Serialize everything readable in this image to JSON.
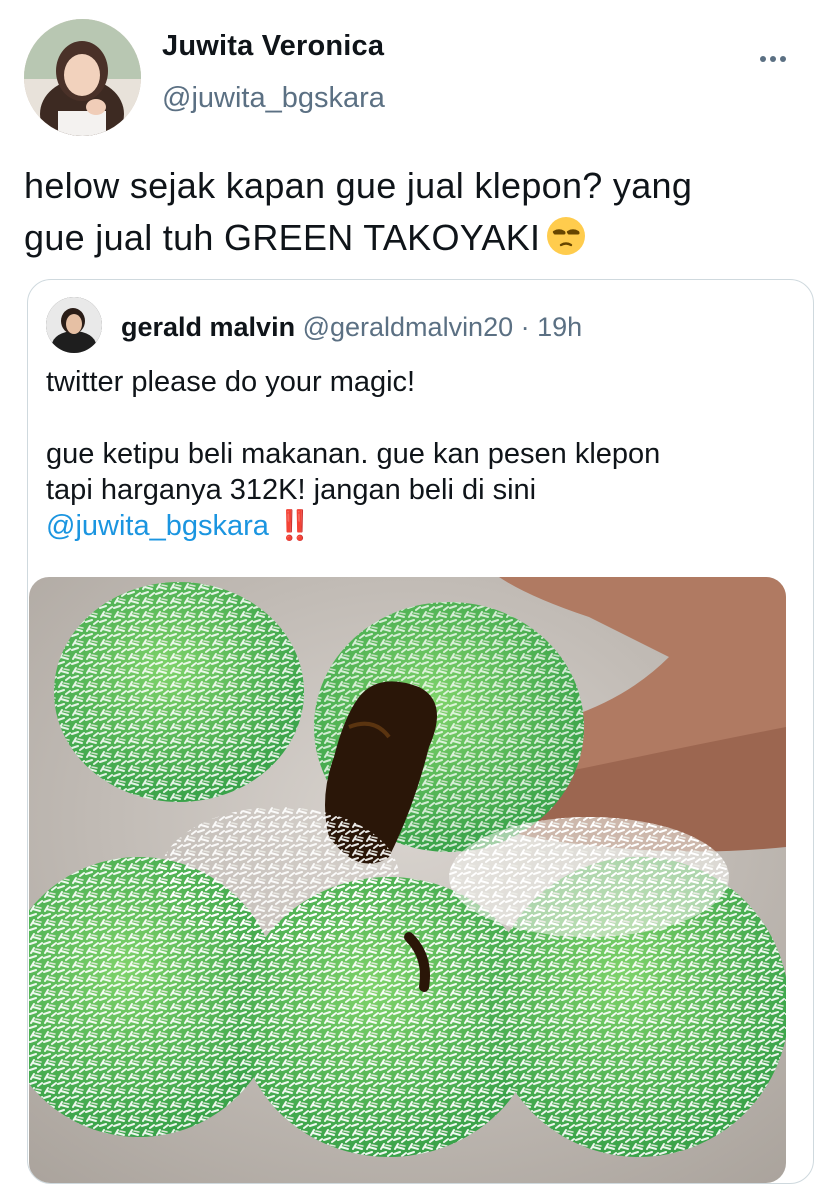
{
  "author": {
    "display_name": "Juwita Veronica",
    "handle": "@juwita_bgskara"
  },
  "tweet": {
    "text_line1": "helow sejak kapan gue jual klepon? yang",
    "text_line2": "gue jual tuh GREEN TAKOYAKI",
    "emoji": "unamused-face"
  },
  "quoted_tweet": {
    "display_name": "gerald malvin",
    "handle": "@geraldmalvin20",
    "separator": "·",
    "time": "19h",
    "text_line1": "twitter please do your magic!",
    "text_line2": "gue ketipu beli makanan. gue kan pesen klepon",
    "text_line3": "tapi harganya 312K! jangan beli di sini",
    "mention": "@juwita_bgskara",
    "mark": "‼️"
  },
  "colors": {
    "text_primary": "#0f1419",
    "text_secondary": "#5b7083",
    "link": "#1b95e0",
    "border": "#cfd9de",
    "alert": "#d0112b"
  }
}
